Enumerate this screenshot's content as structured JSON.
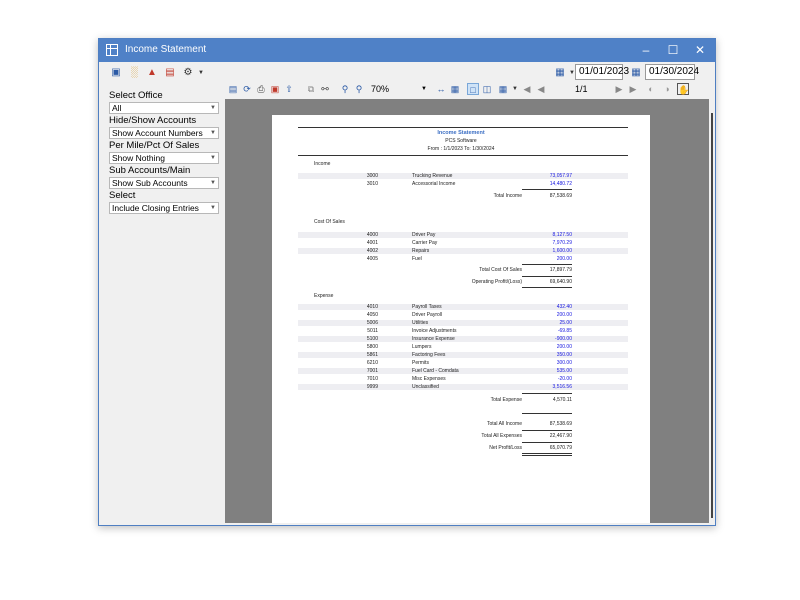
{
  "window": {
    "title": "Income Statement"
  },
  "toolbar": {
    "icons": [
      "save-icon",
      "bar-chart-icon",
      "org-chart-icon",
      "stack-icon",
      "gear-icon"
    ],
    "start_date": "01/01/2023",
    "end_date": "01/30/2024"
  },
  "filters": {
    "office_label": "Select Office",
    "office_value": "All",
    "accounts_label": "Hide/Show Accounts",
    "accounts_value": "Show Account Numbers",
    "permile_label": "Per Mile/Pct Of Sales",
    "permile_value": "Show Nothing",
    "subaccounts_label": "Sub Accounts/Main",
    "subaccounts_value": "Show Sub Accounts",
    "select_label": "Select",
    "select_value": "Include Closing Entries"
  },
  "viewer": {
    "zoom": "70%",
    "page": "1/1"
  },
  "report": {
    "title": "Income Statement",
    "company": "PCS Software",
    "range": "From : 1/1/2023  To: 1/30/2024",
    "income_header": "Income",
    "income_rows": [
      {
        "acct": "3000",
        "name": "Trucking Revenue",
        "amount": "73,057.97"
      },
      {
        "acct": "3010",
        "name": "Accessorial Income",
        "amount": "14,480.72"
      }
    ],
    "total_income_label": "Total Income",
    "total_income": "87,538.69",
    "cos_header": "Cost Of Sales",
    "cos_rows": [
      {
        "acct": "4000",
        "name": "Driver Pay",
        "amount": "8,127.50"
      },
      {
        "acct": "4001",
        "name": "Carrier Pay",
        "amount": "7,970.29"
      },
      {
        "acct": "4002",
        "name": "Repairs",
        "amount": "1,600.00"
      },
      {
        "acct": "4005",
        "name": "Fuel",
        "amount": "200.00"
      }
    ],
    "total_cos_label": "Total Cost Of Sales",
    "total_cos": "17,897.79",
    "op_profit_label": "Operating Profit/(Loss)",
    "op_profit": "69,640.90",
    "expense_header": "Expense",
    "expense_rows": [
      {
        "acct": "4010",
        "name": "Payroll Taxes",
        "amount": "432.40"
      },
      {
        "acct": "4050",
        "name": "Driver Payroll",
        "amount": "200.00"
      },
      {
        "acct": "5006",
        "name": "Utilities",
        "amount": "25.00"
      },
      {
        "acct": "5011",
        "name": "Invoice Adjustments",
        "amount": "-69.85"
      },
      {
        "acct": "5100",
        "name": "Insurance Expense",
        "amount": "-900.00"
      },
      {
        "acct": "5800",
        "name": "Lumpers",
        "amount": "200.00"
      },
      {
        "acct": "5861",
        "name": "Factoring Fees",
        "amount": "350.00"
      },
      {
        "acct": "6210",
        "name": "Permits",
        "amount": "300.00"
      },
      {
        "acct": "7001",
        "name": "Fuel Card - Comdata",
        "amount": "535.00"
      },
      {
        "acct": "7010",
        "name": "Misc Expenses",
        "amount": "-20.00"
      },
      {
        "acct": "9999",
        "name": "Unclassified",
        "amount": "3,516.56"
      }
    ],
    "total_expense_label": "Total Expense",
    "total_expense": "4,570.11",
    "total_all_income_label": "Total All Income",
    "total_all_income": "87,538.69",
    "total_all_expenses_label": "Total All Expenses",
    "total_all_expenses": "22,467.90",
    "net_profit_label": "Net Profit/Loss",
    "net_profit": "65,070.79"
  }
}
